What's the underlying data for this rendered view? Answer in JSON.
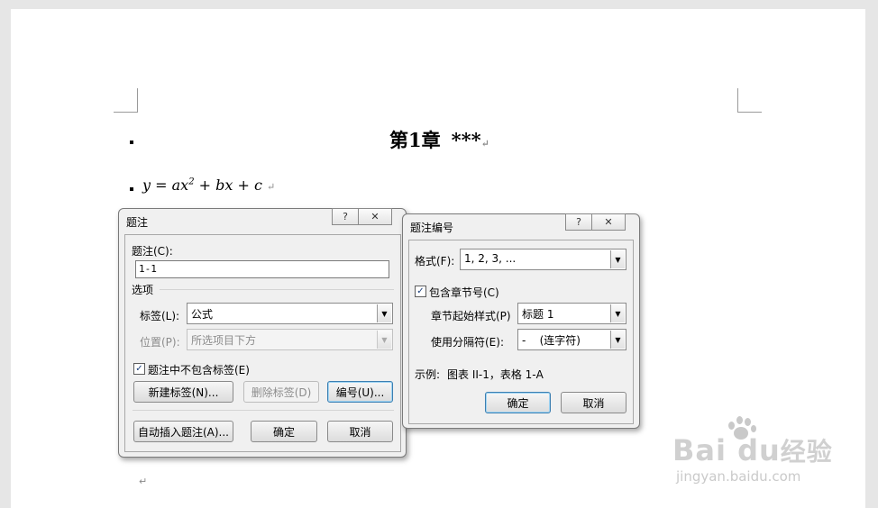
{
  "document": {
    "heading": {
      "part1": "第1章",
      "part2": "***"
    },
    "formula": {
      "lhs": "y = ax",
      "exp": "2",
      "rhs": " + bx + c"
    },
    "return_mark": "↵"
  },
  "caption_dialog": {
    "title": "题注",
    "help_label": "?",
    "close_label": "✕",
    "caption_label": "题注(C):",
    "caption_value": "1-1",
    "options_label": "选项",
    "label_label": "标签(L):",
    "label_value": "公式",
    "position_label": "位置(P):",
    "position_value": "所选项目下方",
    "exclude_label_text": "题注中不包含标签(E)",
    "exclude_label_checked": true,
    "new_label_button": "新建标签(N)...",
    "delete_label_button": "删除标签(D)",
    "numbering_button": "编号(U)...",
    "autocaption_button": "自动插入题注(A)...",
    "ok_button": "确定",
    "cancel_button": "取消"
  },
  "numbering_dialog": {
    "title": "题注编号",
    "help_label": "?",
    "close_label": "✕",
    "format_label": "格式(F):",
    "format_value": "1, 2, 3, ...",
    "include_chapter_text": "包含章节号(C)",
    "include_chapter_checked": true,
    "chapter_style_label": "章节起始样式(P)",
    "chapter_style_value": "标题 1",
    "separator_label": "使用分隔符(E):",
    "separator_value": "-    (连字符)",
    "example_label": "示例:",
    "example_value": "图表 II-1，表格 1-A",
    "ok_button": "确定",
    "cancel_button": "取消"
  },
  "watermark": {
    "brand": "Bai  du",
    "sub_brand": "经验",
    "url": "jingyan.baidu.com"
  }
}
